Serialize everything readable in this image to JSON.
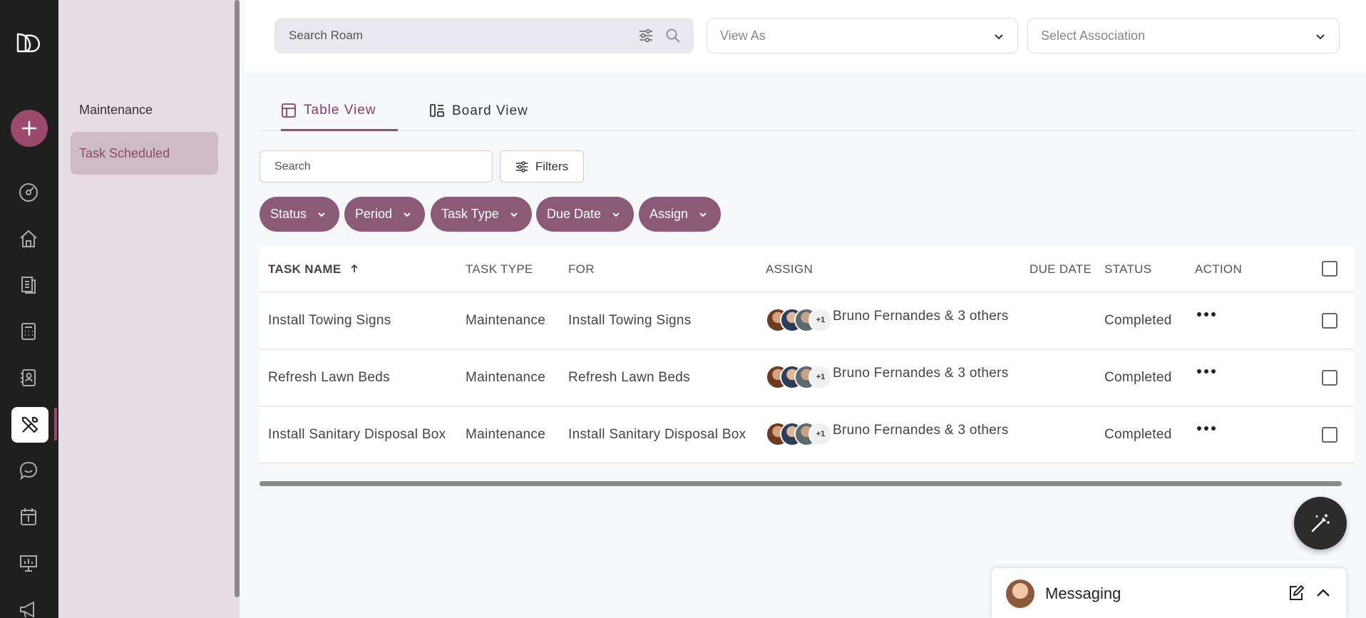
{
  "sidebar": {
    "section": "Maintenance",
    "active_item": "Task Scheduled"
  },
  "topbar": {
    "search_placeholder": "Search Roam",
    "view_as": "View As",
    "association": "Select Association"
  },
  "tabs": [
    {
      "label": "Table View"
    },
    {
      "label": "Board View"
    }
  ],
  "filters": {
    "search_placeholder": "Search",
    "filters_label": "Filters",
    "chips": [
      "Status",
      "Period",
      "Task Type",
      "Due Date",
      "Assign"
    ]
  },
  "table": {
    "headers": {
      "task_name": "TASK NAME",
      "task_type": "TASK TYPE",
      "for": "FOR",
      "assign": "ASSIGN",
      "due_date": "DUE DATE",
      "status": "STATUS",
      "action": "ACTION"
    },
    "rows": [
      {
        "task_name": "Install Towing Signs",
        "task_type": "Maintenance",
        "for": "Install Towing Signs",
        "more": "+1",
        "assignees": "Bruno Fernandes & 3 others",
        "due_date": "",
        "status": "Completed"
      },
      {
        "task_name": "Refresh Lawn Beds",
        "task_type": "Maintenance",
        "for": "Refresh Lawn Beds",
        "more": "+1",
        "assignees": "Bruno Fernandes & 3 others",
        "due_date": "",
        "status": "Completed"
      },
      {
        "task_name": "Install Sanitary Disposal Box",
        "task_type": "Maintenance",
        "for": "Install Sanitary Disposal Box",
        "more": "+1",
        "assignees": "Bruno Fernandes & 3 others",
        "due_date": "",
        "status": "Completed"
      }
    ]
  },
  "messaging": {
    "label": "Messaging"
  },
  "colors": {
    "accent": "#9b4a6c",
    "chip": "#8a5a76",
    "rail": "#1f1f1f",
    "subnav": "#e5dde1"
  }
}
